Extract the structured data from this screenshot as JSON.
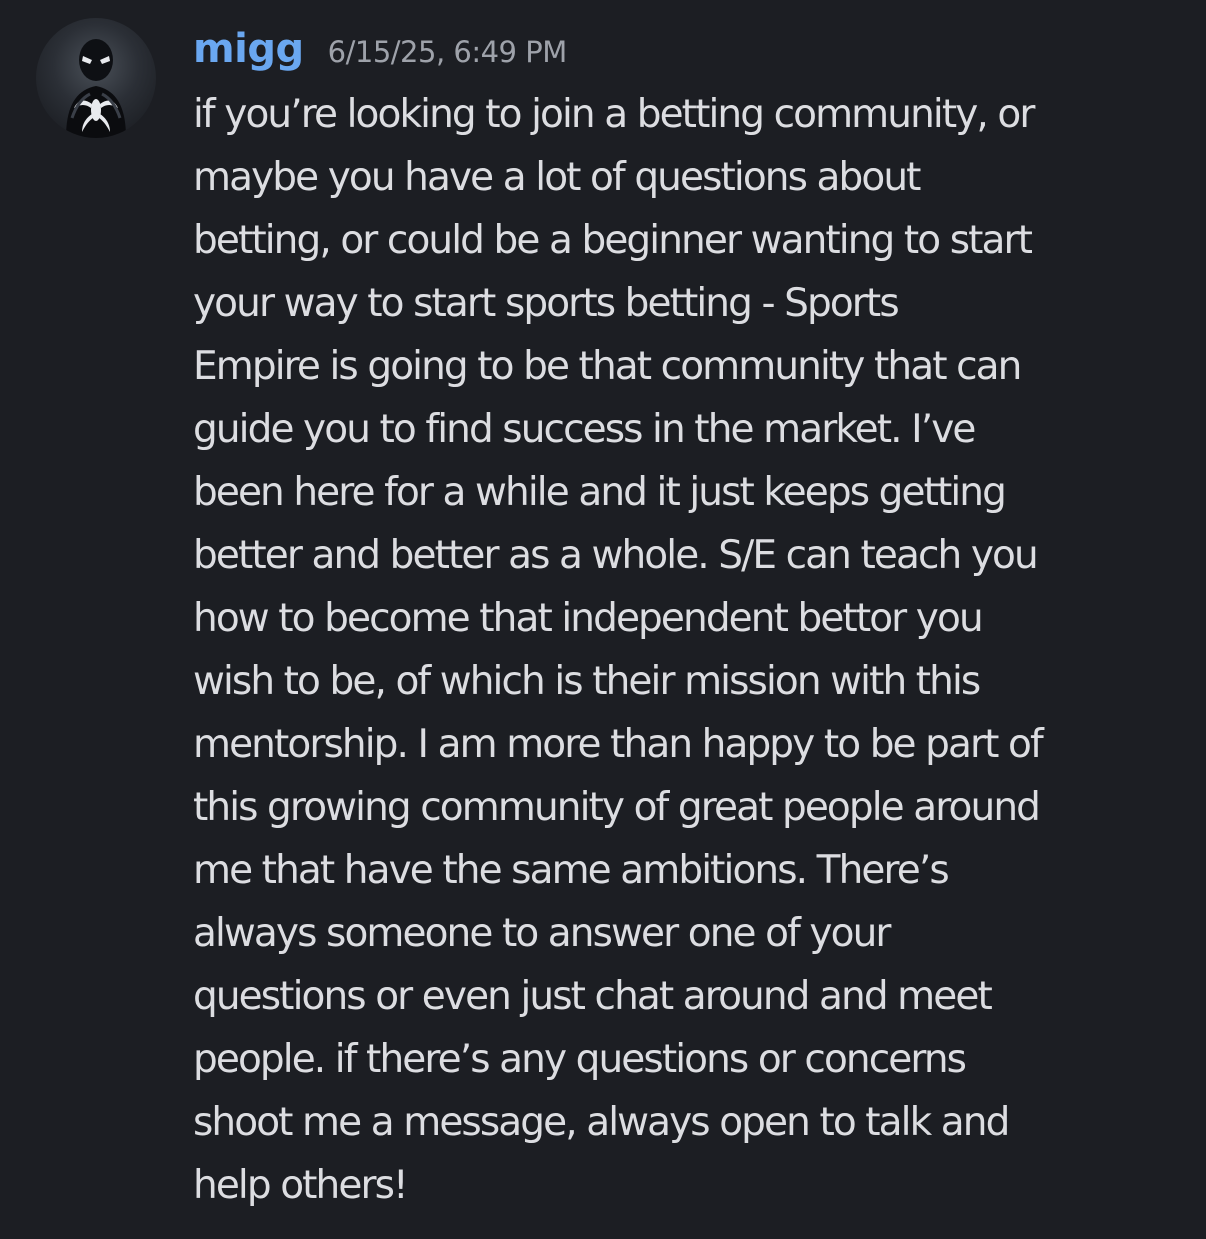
{
  "message": {
    "author": "migg",
    "timestamp": "6/15/25, 6:49 PM",
    "avatar_icon": "spider-symbiote-avatar",
    "lines": [
      "if you’re looking to join a betting community, or",
      "maybe you have a lot of questions about",
      "betting, or could be a beginner wanting to start",
      "your way to start sports betting - Sports",
      "Empire is going to be that community that can",
      "guide you to find success in the market. I’ve",
      "been here for a while and it just keeps getting",
      "better and better as a whole. S/E can teach you",
      "how to become that independent bettor you",
      "wish to be, of which is their mission with this",
      "mentorship. I am more than happy to be part of",
      "this growing community of great people around",
      "me that have the same ambitions. There’s",
      "always someone to answer one of your",
      "questions or even just chat around and meet",
      "people. if there’s any questions or concerns",
      "shoot me a message, always open to talk and",
      "help others!"
    ]
  },
  "colors": {
    "background": "#1c1e23",
    "username": "#6aa7f0",
    "timestamp": "#9ea2aa",
    "text": "#dcdde1"
  }
}
